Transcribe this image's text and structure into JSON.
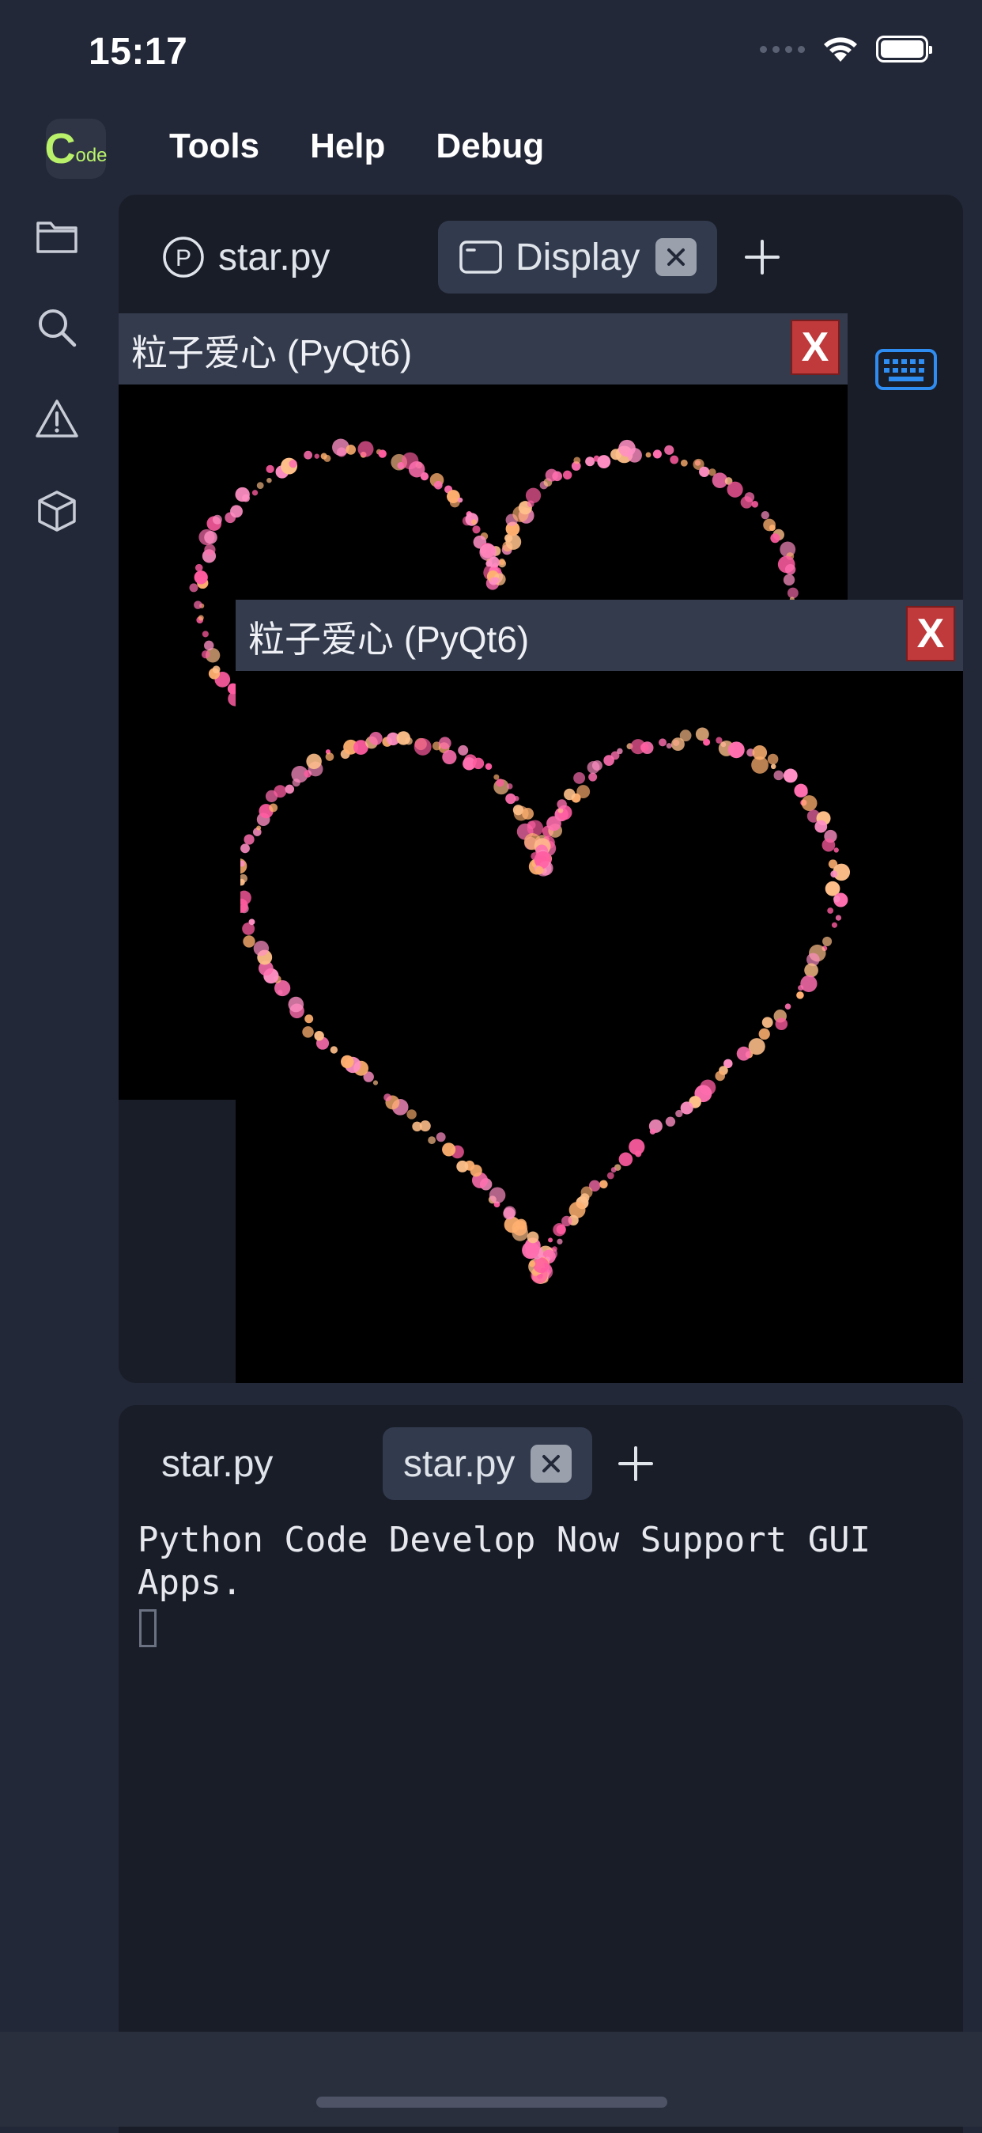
{
  "status_bar": {
    "time": "15:17"
  },
  "app": {
    "logo_big": "C",
    "logo_small": "ode"
  },
  "menu": [
    "Tools",
    "Help",
    "Debug"
  ],
  "sidebar": [
    "folder-icon",
    "search-icon",
    "warning-icon",
    "package-icon"
  ],
  "top_tabs": [
    {
      "label": "star.py",
      "icon": "python-file-icon",
      "active": false
    },
    {
      "label": "Display",
      "icon": "window-icon",
      "active": true
    }
  ],
  "windows": [
    {
      "title": "粒子爱心 (PyQt6)",
      "close_label": "X"
    },
    {
      "title": "粒子爱心 (PyQt6)",
      "close_label": "X"
    }
  ],
  "bottom_tabs": [
    {
      "label": "star.py",
      "active": false
    },
    {
      "label": "star.py",
      "active": true
    }
  ],
  "console": {
    "output": "Python Code Develop Now Support GUI Apps."
  },
  "colors": {
    "background": "#232838",
    "panel": "#191d28",
    "tab_active": "#323a4d",
    "window_titlebar": "#333b4c",
    "close_red": "#c0393b",
    "logo_green": "#b9f26a",
    "keyboard_blue": "#2f8cf0",
    "particle_pink": "#ff6fb0",
    "particle_orange": "#ffb070"
  }
}
